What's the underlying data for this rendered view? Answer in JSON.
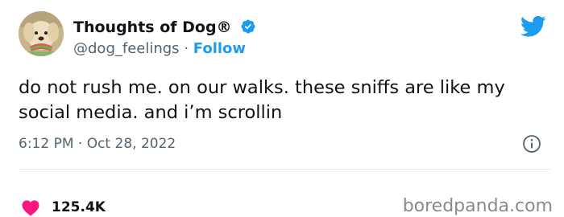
{
  "author": {
    "name": "Thoughts of Dog®",
    "handle": "@dog_feelings",
    "separator": "·",
    "follow_label": "Follow"
  },
  "tweet": {
    "text": "do not rush me. on our walks. these sniffs are like my social media. and i’m scrollin",
    "timestamp": "6:12 PM · Oct 28, 2022"
  },
  "engagement": {
    "likes": "125.4K"
  },
  "watermark": "boredpanda.com",
  "icons": {
    "verified": "verified-badge-icon",
    "platform": "twitter-bird-icon",
    "info": "info-icon",
    "like": "heart-icon"
  },
  "colors": {
    "accent": "#1d9bf0",
    "secondary_text": "#536471",
    "like": "#f91880",
    "watermark": "#8a8a8a"
  }
}
